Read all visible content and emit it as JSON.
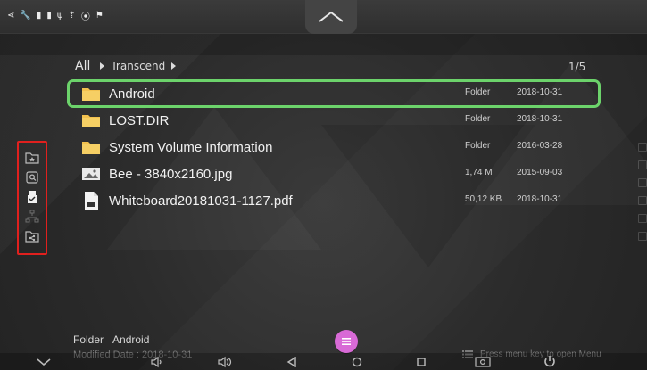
{
  "breadcrumb": {
    "root": "All",
    "segment": "Transcend"
  },
  "pager": "1/5",
  "files": [
    {
      "name": "Android",
      "type": "Folder",
      "date": "2018-10-31",
      "icon": "folder-icon",
      "selected": true
    },
    {
      "name": "LOST.DIR",
      "type": "Folder",
      "date": "2018-10-31",
      "icon": "folder-icon",
      "selected": false
    },
    {
      "name": "System Volume Information",
      "type": "Folder",
      "date": "2016-03-28",
      "icon": "folder-icon",
      "selected": false
    },
    {
      "name": "Bee - 3840x2160.jpg",
      "type": "1,74 M",
      "date": "2015-09-03",
      "icon": "image-icon",
      "selected": false
    },
    {
      "name": "Whiteboard20181031-1127.pdf",
      "type": "50,12 KB",
      "date": "2018-10-31",
      "icon": "pdf-icon",
      "selected": false
    }
  ],
  "details": {
    "type": "Folder",
    "name": "Android",
    "modified": "Modified Date : 2018-10-31"
  },
  "menu_hint": "Press menu key to open Menu",
  "colors": {
    "selection": "#6cd36b",
    "highlight_box": "#e0201e",
    "menu_button": "#d86ad6",
    "folder": "#f2c14e"
  },
  "icons": {
    "status": [
      "share-icon",
      "wrench-icon",
      "person-icon",
      "person-icon",
      "usb-icon",
      "upload-icon",
      "location-icon",
      "flag-icon"
    ],
    "left_toolbar": [
      "folder-star-icon",
      "search-folder-icon",
      "usb-drive-icon",
      "network-icon",
      "share-folder-icon"
    ],
    "nav": [
      "home-collapse-icon",
      "volume-down-icon",
      "volume-up-icon",
      "back-icon",
      "home-icon",
      "recent-apps-icon",
      "screenshot-icon",
      "power-icon"
    ]
  }
}
